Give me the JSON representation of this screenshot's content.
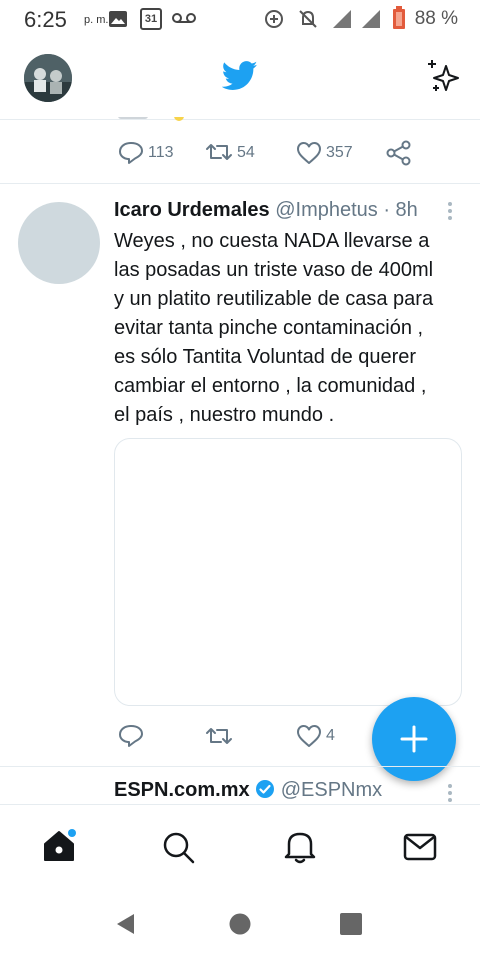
{
  "status_bar": {
    "time": "6:25",
    "ampm": "p. m.",
    "calendar_day": "31",
    "battery": "88 %"
  },
  "prev_tweet": {
    "replies": "113",
    "retweets": "54",
    "likes": "357"
  },
  "tweet": {
    "name": "Icaro Urdemales",
    "handle": "@Imphetus",
    "time": "· 8h",
    "lines": [
      "Weyes , no cuesta NADA llevarse a",
      "las posadas un triste vaso de 400ml",
      "y un platito reutilizable de casa para",
      "evitar tanta pinche contaminación ,",
      "es sólo Tantita Voluntad de querer",
      "cambiar el entorno , la comunidad ,",
      "el país , nuestro mundo ."
    ],
    "likes": "4"
  },
  "next_tweet": {
    "name": "ESPN.com.mx",
    "handle": "@ESPNmx"
  },
  "colors": {
    "brand": "#1da1f2",
    "text_primary": "#14171a",
    "text_secondary": "#657786",
    "border": "#e6ecf0"
  },
  "icons": [
    "twitter-bird-icon",
    "sparkle-icon",
    "reply-icon",
    "retweet-icon",
    "like-icon",
    "share-icon",
    "more-icon",
    "verified-icon",
    "compose-plus-icon",
    "home-icon",
    "search-icon",
    "notifications-icon",
    "messages-icon",
    "android-back-icon",
    "android-home-icon",
    "android-recents-icon"
  ]
}
